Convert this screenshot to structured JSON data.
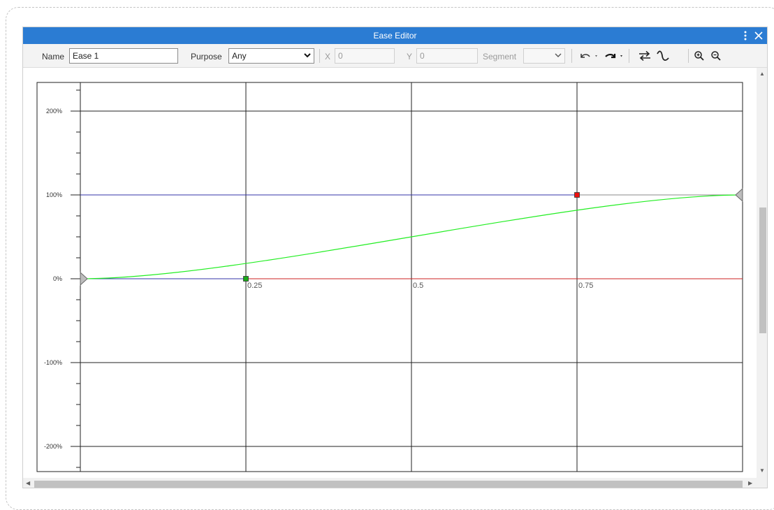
{
  "window": {
    "title": "Ease Editor"
  },
  "toolbar": {
    "name_label": "Name",
    "name_value": "Ease 1",
    "purpose_label": "Purpose",
    "purpose_value": "Any",
    "x_label": "X",
    "x_value": "0",
    "y_label": "Y",
    "y_value": "0",
    "segment_label": "Segment",
    "segment_value": ""
  },
  "icons": {
    "more": "more-vertical-icon",
    "close": "close-icon",
    "undo": "undo-icon",
    "redo": "redo-icon",
    "swap": "swap-icon",
    "curve": "curve-icon",
    "zoom_in": "zoom-in-icon",
    "zoom_out": "zoom-out-icon"
  },
  "colors": {
    "titlebar": "#2b7cd3",
    "curve": "#22ee22",
    "handle_start": "#1aaa1a",
    "handle_end": "#ee1111",
    "line_target": "#3333aa",
    "line_base": "#cc2222"
  },
  "chart_data": {
    "type": "line",
    "x_range": [
      0,
      1
    ],
    "y_range": [
      -2.25,
      2.25
    ],
    "x_gridlines": [
      0.25,
      0.5,
      0.75
    ],
    "x_tick_labels": [
      "0.25",
      "0.5",
      "0.75"
    ],
    "y_gridlines": [
      2,
      1,
      0,
      -1,
      -2
    ],
    "y_tick_labels": [
      "200%",
      "100%",
      "0%",
      "-100%",
      "-200%"
    ],
    "curve": {
      "start": [
        0,
        0
      ],
      "control1": [
        0.25,
        0
      ],
      "control2": [
        0.75,
        1
      ],
      "end": [
        1,
        1
      ]
    }
  }
}
